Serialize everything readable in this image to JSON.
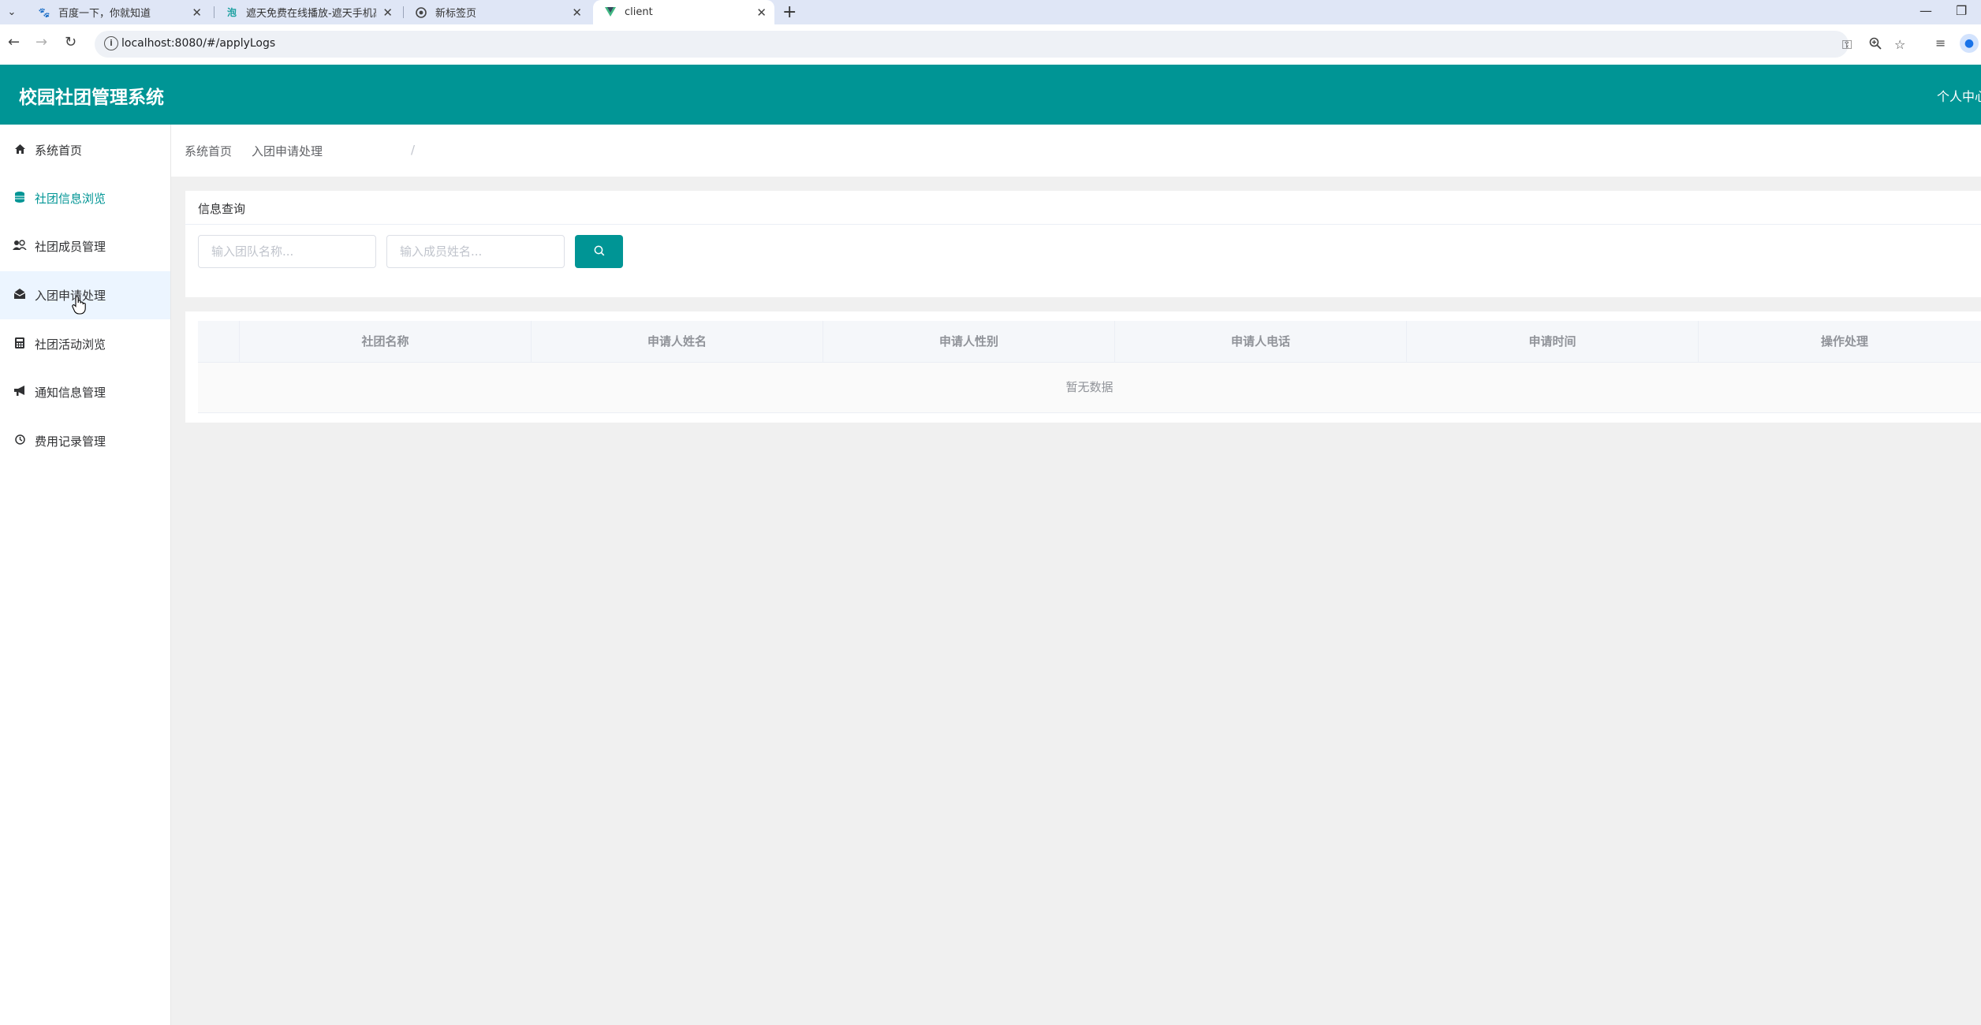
{
  "browser": {
    "tabs": [
      {
        "title": "百度一下，你就知道",
        "icon": "baidu-icon"
      },
      {
        "title": "遮天免费在线播放-遮天手机高清",
        "icon": "video-site-icon"
      },
      {
        "title": "新标签页",
        "icon": "chrome-icon"
      },
      {
        "title": "client",
        "icon": "vue-icon"
      }
    ],
    "url": "localhost:8080/#/applyLogs"
  },
  "header": {
    "title": "校园社团管理系统",
    "user_center": "个人中心"
  },
  "sidebar": {
    "items": [
      {
        "label": "系统首页",
        "icon": "home-icon"
      },
      {
        "label": "社团信息浏览",
        "icon": "database-icon"
      },
      {
        "label": "社团成员管理",
        "icon": "users-icon"
      },
      {
        "label": "入团申请处理",
        "icon": "envelope-open-icon"
      },
      {
        "label": "社团活动浏览",
        "icon": "calculator-icon"
      },
      {
        "label": "通知信息管理",
        "icon": "bullhorn-icon"
      },
      {
        "label": "费用记录管理",
        "icon": "clock-icon"
      }
    ]
  },
  "breadcrumb": {
    "home": "系统首页",
    "separator": "/",
    "current": "入团申请处理"
  },
  "query": {
    "title": "信息查询",
    "team_placeholder": "输入团队名称...",
    "member_placeholder": "输入成员姓名..."
  },
  "table": {
    "columns": [
      "",
      "社团名称",
      "申请人姓名",
      "申请人性别",
      "申请人电话",
      "申请时间",
      "操作处理"
    ],
    "empty_text": "暂无数据"
  },
  "colors": {
    "brand": "#009595",
    "menu_active_bg": "#ecf5ff"
  }
}
